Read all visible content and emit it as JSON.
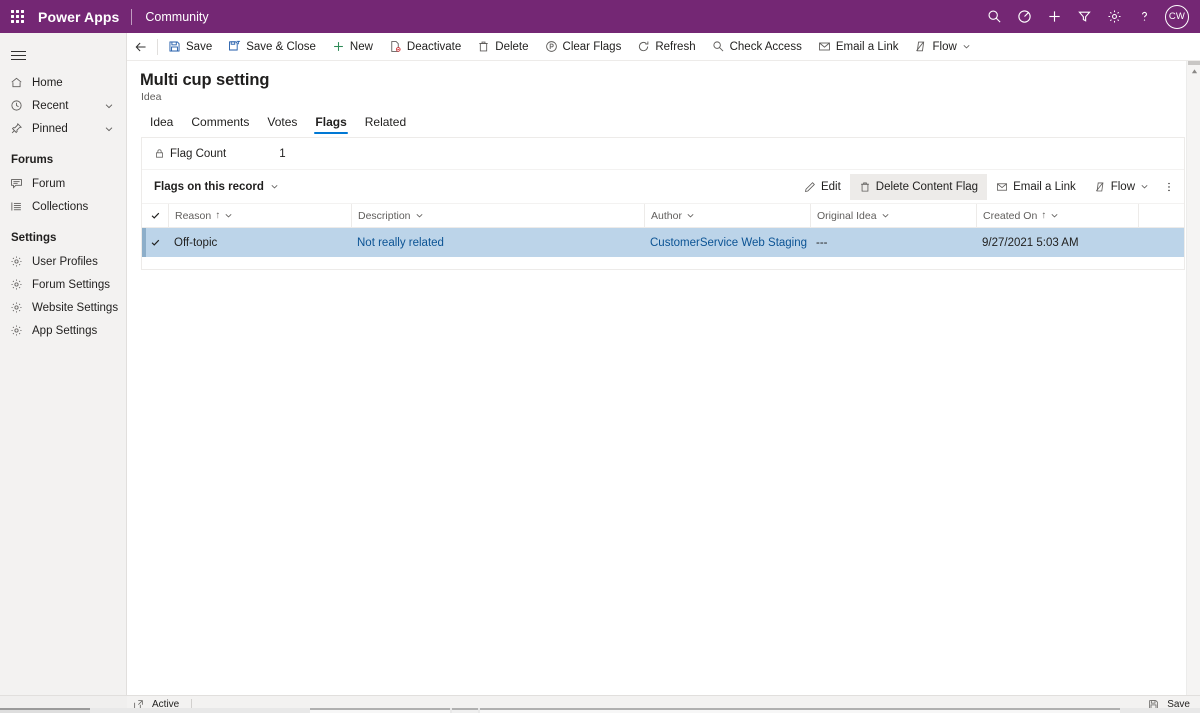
{
  "topbar": {
    "waffle_label": "app-launcher",
    "brand": "Power Apps",
    "app_name": "Community",
    "icons": [
      {
        "name": "search-icon",
        "label": "Search"
      },
      {
        "name": "target-icon",
        "label": "Assistant"
      },
      {
        "name": "plus-icon",
        "label": "New"
      },
      {
        "name": "filter-icon",
        "label": "Filter"
      },
      {
        "name": "gear-icon",
        "label": "Settings"
      },
      {
        "name": "help-icon",
        "label": "Help"
      }
    ],
    "avatar_initials": "CW",
    "background": "#742774"
  },
  "sidebar": {
    "items": [
      {
        "label": "Home",
        "icon": "home-icon",
        "chevron": false
      },
      {
        "label": "Recent",
        "icon": "clock-icon",
        "chevron": true
      },
      {
        "label": "Pinned",
        "icon": "pin-icon",
        "chevron": true
      }
    ],
    "groups": [
      {
        "title": "Forums",
        "items": [
          {
            "label": "Forum",
            "icon": "forum-icon"
          },
          {
            "label": "Collections",
            "icon": "list-icon"
          }
        ]
      },
      {
        "title": "Settings",
        "items": [
          {
            "label": "User Profiles",
            "icon": "gear-icon"
          },
          {
            "label": "Forum Settings",
            "icon": "gear-icon"
          },
          {
            "label": "Website Settings",
            "icon": "gear-icon"
          },
          {
            "label": "App Settings",
            "icon": "gear-icon"
          }
        ]
      }
    ]
  },
  "commandbar": {
    "back_label": "Back",
    "buttons": [
      {
        "label": "Save",
        "icon": "save-icon"
      },
      {
        "label": "Save & Close",
        "icon": "save-close-icon"
      },
      {
        "label": "New",
        "icon": "plus-icon"
      },
      {
        "label": "Deactivate",
        "icon": "deactivate-icon"
      },
      {
        "label": "Delete",
        "icon": "trash-icon"
      },
      {
        "label": "Clear Flags",
        "icon": "clear-flags-icon"
      },
      {
        "label": "Refresh",
        "icon": "refresh-icon"
      },
      {
        "label": "Check Access",
        "icon": "check-access-icon"
      },
      {
        "label": "Email a Link",
        "icon": "email-link-icon"
      },
      {
        "label": "Flow",
        "icon": "flow-icon",
        "chevron": true
      }
    ]
  },
  "record": {
    "title": "Multi cup setting",
    "subtitle": "Idea"
  },
  "tabs": [
    {
      "label": "Idea",
      "active": false
    },
    {
      "label": "Comments",
      "active": false
    },
    {
      "label": "Votes",
      "active": false
    },
    {
      "label": "Flags",
      "active": true,
      "annotated": true
    },
    {
      "label": "Related",
      "active": false
    }
  ],
  "annotation_color": "#e81123",
  "form": {
    "flag_count_label": "Flag Count",
    "flag_count_value": "1",
    "flag_count_icon": "lock-icon"
  },
  "subgrid": {
    "title": "Flags on this record",
    "commands": [
      {
        "label": "Edit",
        "icon": "edit-icon",
        "selected": false
      },
      {
        "label": "Delete Content Flag",
        "icon": "trash-icon",
        "selected": true
      },
      {
        "label": "Email a Link",
        "icon": "email-link-icon",
        "selected": false
      },
      {
        "label": "Flow",
        "icon": "flow-icon",
        "selected": false,
        "chevron": true
      }
    ],
    "more_label": "More commands",
    "columns": [
      {
        "label": "Reason",
        "sort": "asc"
      },
      {
        "label": "Description",
        "sort": null
      },
      {
        "label": "Author",
        "sort": null
      },
      {
        "label": "Original Idea",
        "sort": null
      },
      {
        "label": "Created On",
        "sort": "asc"
      }
    ],
    "rows": [
      {
        "selected": true,
        "reason": "Off-topic",
        "description": "Not really related",
        "author": "CustomerService Web Staging",
        "original_idea": "---",
        "created_on": "9/27/2021 5:03 AM"
      }
    ],
    "selected_row_bg": "#bcd4e9"
  },
  "statusbar": {
    "state_label": "Active",
    "save_label": "Save",
    "state_icon": "popout-icon",
    "save_icon": "save-icon"
  }
}
